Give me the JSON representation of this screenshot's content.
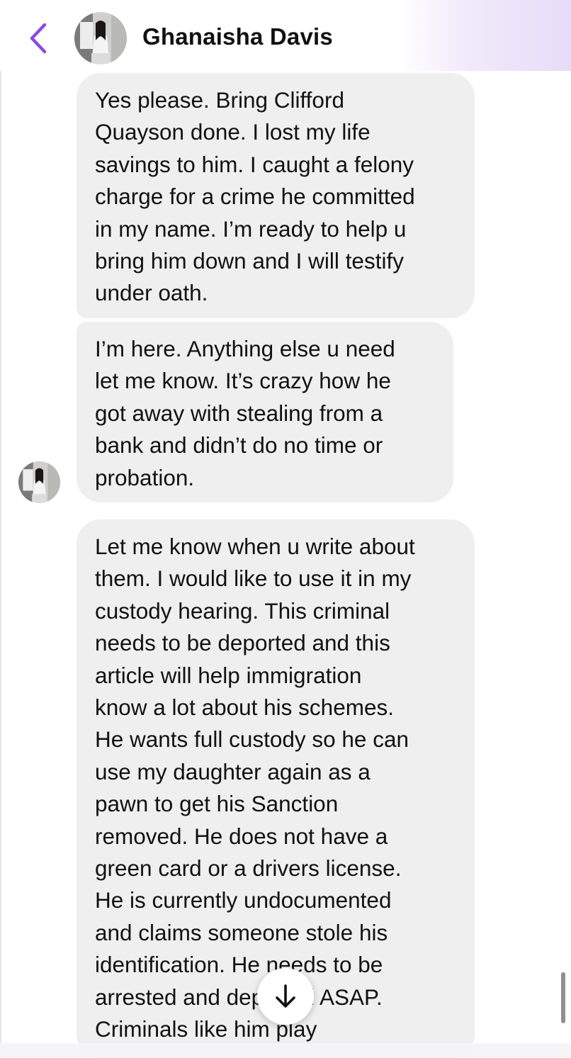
{
  "header": {
    "back_icon": "chevron-left-icon",
    "contact_name": "Ghanaisha Davis",
    "accent_color": "#8a4ae0"
  },
  "messages": [
    {
      "sender": "Ghanaisha Davis",
      "text": "Yes please. Bring Clifford\nQuayson done. I lost my life\nsavings to him. I caught a felony\ncharge for a crime he committed\nin my name. I’m ready to help u\nbring him down and I will testify\nunder oath."
    },
    {
      "sender": "Ghanaisha Davis",
      "text": "I’m here. Anything else u need\nlet me know. It’s crazy how he\ngot away with stealing from a\nbank and didn’t do no time or\nprobation."
    },
    {
      "sender": "Ghanaisha Davis",
      "text": "Let me know when u write about\nthem. I would like to use it in my\ncustody hearing. This criminal\nneeds to be deported and this\narticle will help immigration\nknow a lot about his schemes.\nHe wants full custody so he can\nuse my daughter again as a\npawn to get his Sanction\nremoved. He does not have a\ngreen card or a drivers license.\nHe is currently undocumented\nand claims someone stole his\nidentification. He needs to be\narrested and deported ASAP.\nCriminals like him play"
    }
  ],
  "controls": {
    "scroll_down_icon": "arrow-down-icon"
  },
  "colors": {
    "incoming_bubble": "#efeff0",
    "header_gradient": "#e7dcf8"
  }
}
